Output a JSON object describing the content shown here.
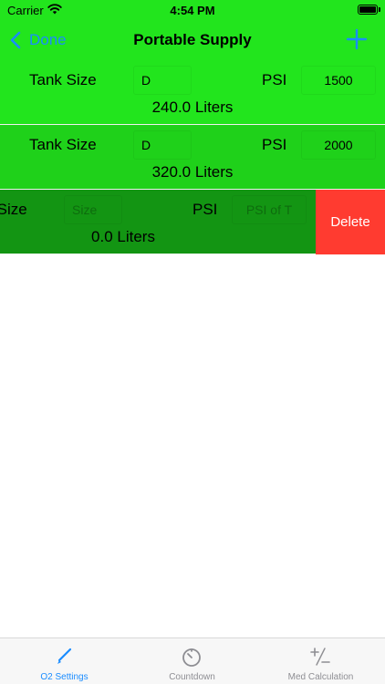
{
  "status_bar": {
    "carrier": "Carrier",
    "time": "4:54 PM"
  },
  "nav": {
    "back_label": "Done",
    "title": "Portable Supply"
  },
  "rows": [
    {
      "size_label": "Tank Size",
      "size_value": "D",
      "psi_label": "PSI",
      "psi_value": "1500",
      "liters": "240.0 Liters"
    },
    {
      "size_label": "Tank Size",
      "size_value": "D",
      "psi_label": "PSI",
      "psi_value": "2000",
      "liters": "320.0 Liters"
    },
    {
      "size_label": "Tank Size",
      "size_placeholder": "Size",
      "psi_label": "PSI",
      "psi_placeholder": "PSI of T",
      "liters": "0.0 Liters"
    }
  ],
  "row_actions": {
    "delete_label": "Delete"
  },
  "tabs": [
    {
      "label": "O2 Settings",
      "icon": "pencil-icon",
      "selected": true
    },
    {
      "label": "Countdown",
      "icon": "timer-icon",
      "selected": false
    },
    {
      "label": "Med Calculation",
      "icon": "plus-minus-icon",
      "selected": false
    }
  ],
  "colors": {
    "accent": "#1a8cff",
    "row1": "#22e51d",
    "row2": "#1fd11a",
    "row3": "#139513",
    "delete": "#ff3b30"
  }
}
